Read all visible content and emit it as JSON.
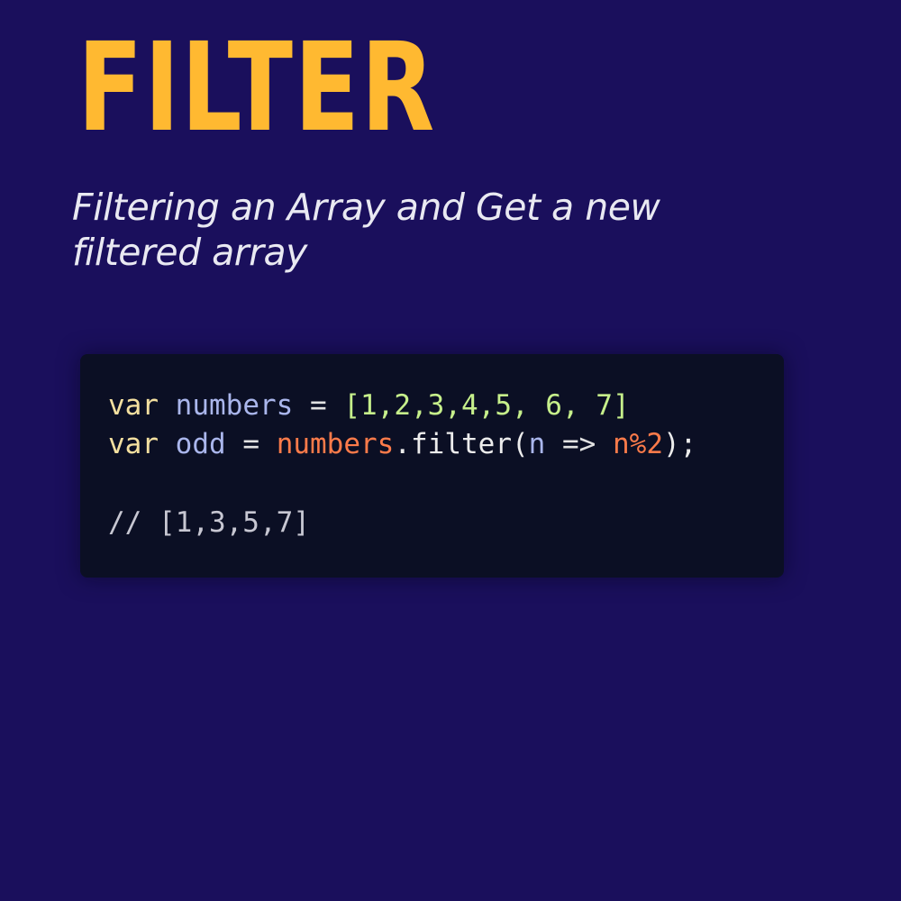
{
  "heading": {
    "title": "FILTER",
    "subtitle": "Filtering an Array and Get a new filtered array"
  },
  "code": {
    "line1": {
      "keyword": "var",
      "name": "numbers",
      "equals": "=",
      "value": "[1,2,3,4,5, 6, 7]"
    },
    "line2": {
      "keyword": "var",
      "name": "odd",
      "equals": "=",
      "object": "numbers",
      "method": ".filter(",
      "param": "n",
      "arrow": "=>",
      "body": "n%2",
      "end": ");"
    },
    "comment": "// [1,3,5,7]"
  },
  "colors": {
    "background": "#1a0f5c",
    "title": "#ffb931",
    "code_background": "#0b0f24",
    "keyword": "#f4e0a0",
    "variable": "#aab6ec",
    "number": "#c6ef8b",
    "reference": "#fd7b4a"
  }
}
